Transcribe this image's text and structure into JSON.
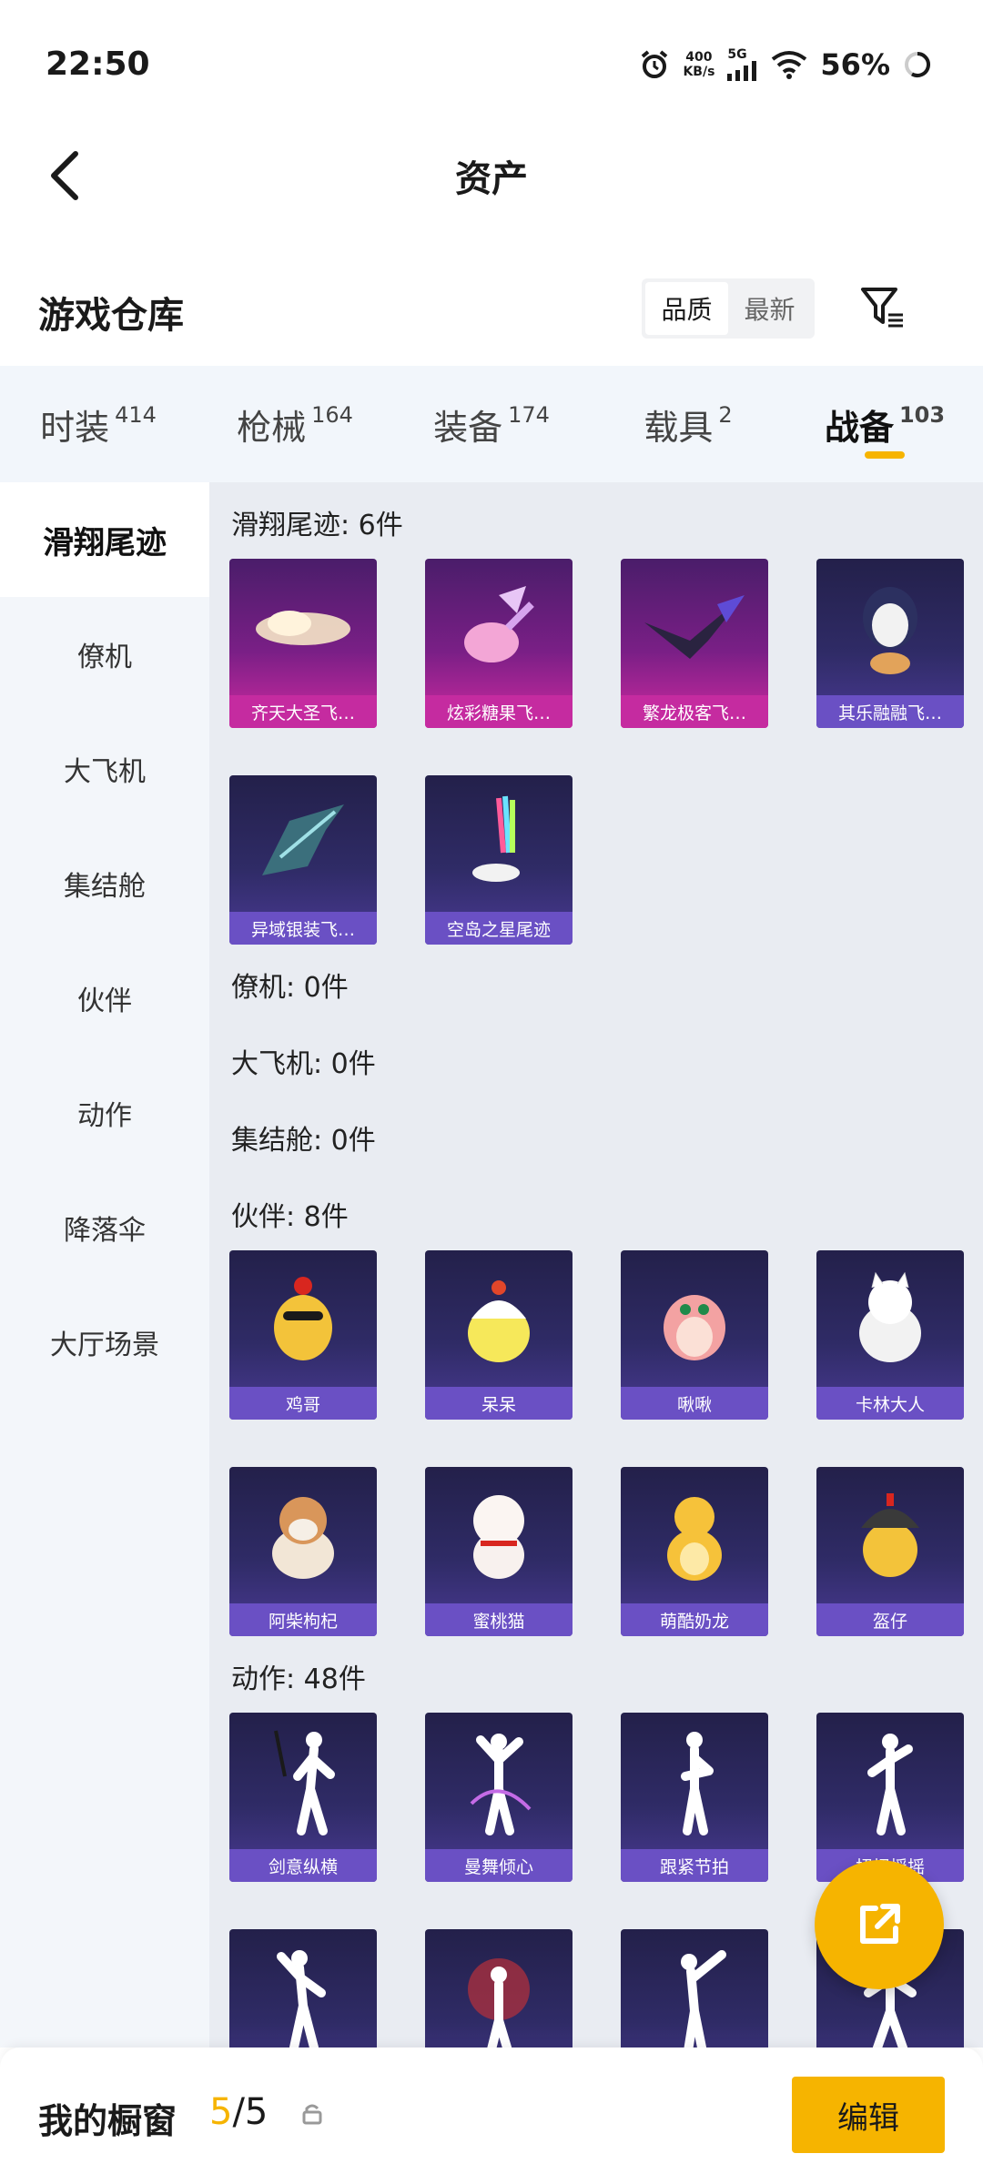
{
  "status": {
    "time": "22:50",
    "net_speed_value": "400",
    "net_speed_unit": "KB/s",
    "network": "5G",
    "battery": "56%"
  },
  "nav": {
    "title": "资产"
  },
  "warehouse": {
    "title": "游戏仓库",
    "sort_options": [
      "品质",
      "最新"
    ],
    "active_sort": "品质"
  },
  "tabs": [
    {
      "label": "时装",
      "count": "414"
    },
    {
      "label": "枪械",
      "count": "164"
    },
    {
      "label": "装备",
      "count": "174"
    },
    {
      "label": "载具",
      "count": "2"
    },
    {
      "label": "战备",
      "count": "103"
    }
  ],
  "active_tab": "战备",
  "sidebar": [
    "滑翔尾迹",
    "僚机",
    "大飞机",
    "集结舱",
    "伙伴",
    "动作",
    "降落伞",
    "大厅场景"
  ],
  "groups": [
    {
      "title": "滑翔尾迹: 6件"
    },
    {
      "title": "僚机: 0件"
    },
    {
      "title": "大飞机: 0件"
    },
    {
      "title": "集结舱: 0件"
    },
    {
      "title": "伙伴: 8件"
    },
    {
      "title": "动作: 48件"
    }
  ],
  "items": {
    "trails": [
      "齐天大圣飞…",
      "炫彩糖果飞…",
      "繁龙极客飞…",
      "其乐融融飞…",
      "异域银装飞…",
      "空岛之星尾迹"
    ],
    "partners": [
      "鸡哥",
      "呆呆",
      "啾啾",
      "卡林大人",
      "阿柴枸杞",
      "蜜桃猫",
      "萌酷奶龙",
      "盔仔"
    ],
    "actions": [
      "剑意纵横",
      "曼舞倾心",
      "跟紧节拍",
      "扭扭摇摇",
      "",
      "",
      "",
      ""
    ]
  },
  "showcase": {
    "title": "我的橱窗",
    "current": "5",
    "total": "/5",
    "edit_label": "编辑"
  },
  "colors": {
    "accent": "#f6b400",
    "rare_pink": "#c52ba0",
    "epic_purple": "#6a50c4"
  }
}
